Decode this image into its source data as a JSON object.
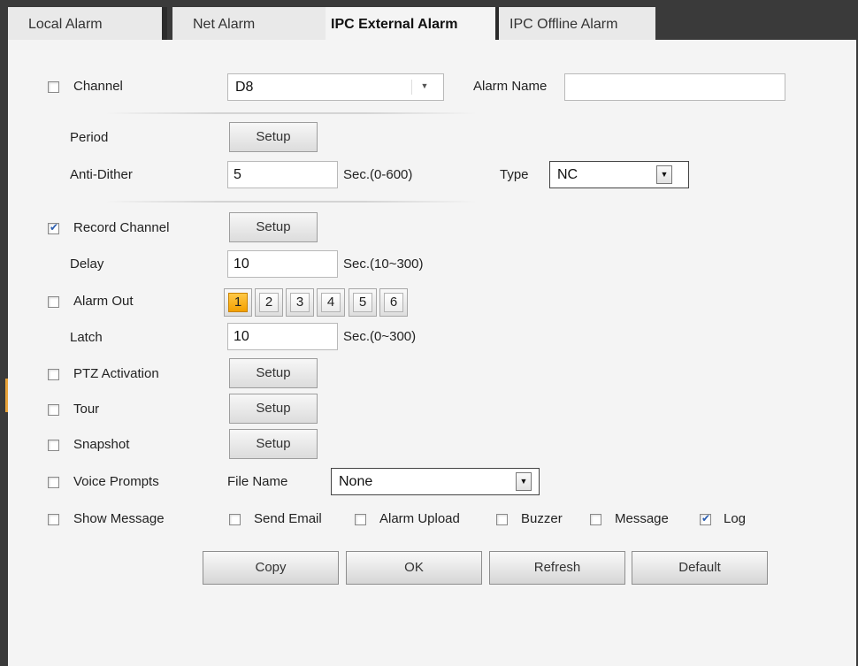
{
  "tabs": [
    {
      "label": "Local Alarm"
    },
    {
      "label": "Net Alarm"
    },
    {
      "label": "IPC External Alarm"
    },
    {
      "label": "IPC Offline Alarm"
    }
  ],
  "channel": {
    "label": "Channel",
    "checked": false,
    "value": "D8"
  },
  "alarm_name": {
    "label": "Alarm Name",
    "value": ""
  },
  "period": {
    "label": "Period",
    "button": "Setup"
  },
  "anti_dither": {
    "label": "Anti-Dither",
    "value": "5",
    "unit": "Sec.(0-600)"
  },
  "type": {
    "label": "Type",
    "value": "NC"
  },
  "record_channel": {
    "label": "Record Channel",
    "checked": true,
    "button": "Setup"
  },
  "delay": {
    "label": "Delay",
    "value": "10",
    "unit": "Sec.(10~300)"
  },
  "alarm_out": {
    "label": "Alarm Out",
    "checked": false,
    "outputs": [
      "1",
      "2",
      "3",
      "4",
      "5",
      "6"
    ],
    "active": "1"
  },
  "latch": {
    "label": "Latch",
    "value": "10",
    "unit": "Sec.(0~300)"
  },
  "ptz_activation": {
    "label": "PTZ Activation",
    "checked": false,
    "button": "Setup"
  },
  "tour": {
    "label": "Tour",
    "checked": false,
    "button": "Setup"
  },
  "snapshot": {
    "label": "Snapshot",
    "checked": false,
    "button": "Setup"
  },
  "voice_prompts": {
    "label": "Voice Prompts",
    "checked": false,
    "file_label": "File Name",
    "file_value": "None"
  },
  "show_message": {
    "label": "Show Message",
    "checked": false
  },
  "options": {
    "send_email": {
      "label": "Send Email",
      "checked": false
    },
    "alarm_upload": {
      "label": "Alarm Upload",
      "checked": false
    },
    "buzzer": {
      "label": "Buzzer",
      "checked": false
    },
    "message": {
      "label": "Message",
      "checked": false
    },
    "log": {
      "label": "Log",
      "checked": true
    }
  },
  "actions": {
    "copy": "Copy",
    "ok": "OK",
    "refresh": "Refresh",
    "default": "Default"
  },
  "colors": {
    "active_output": "#f3a000",
    "border": "#3a3a3a",
    "check": "#2a5db0"
  },
  "icons": {
    "dropdown": "chevron-down-icon",
    "checkbox": "checkbox-icon"
  }
}
